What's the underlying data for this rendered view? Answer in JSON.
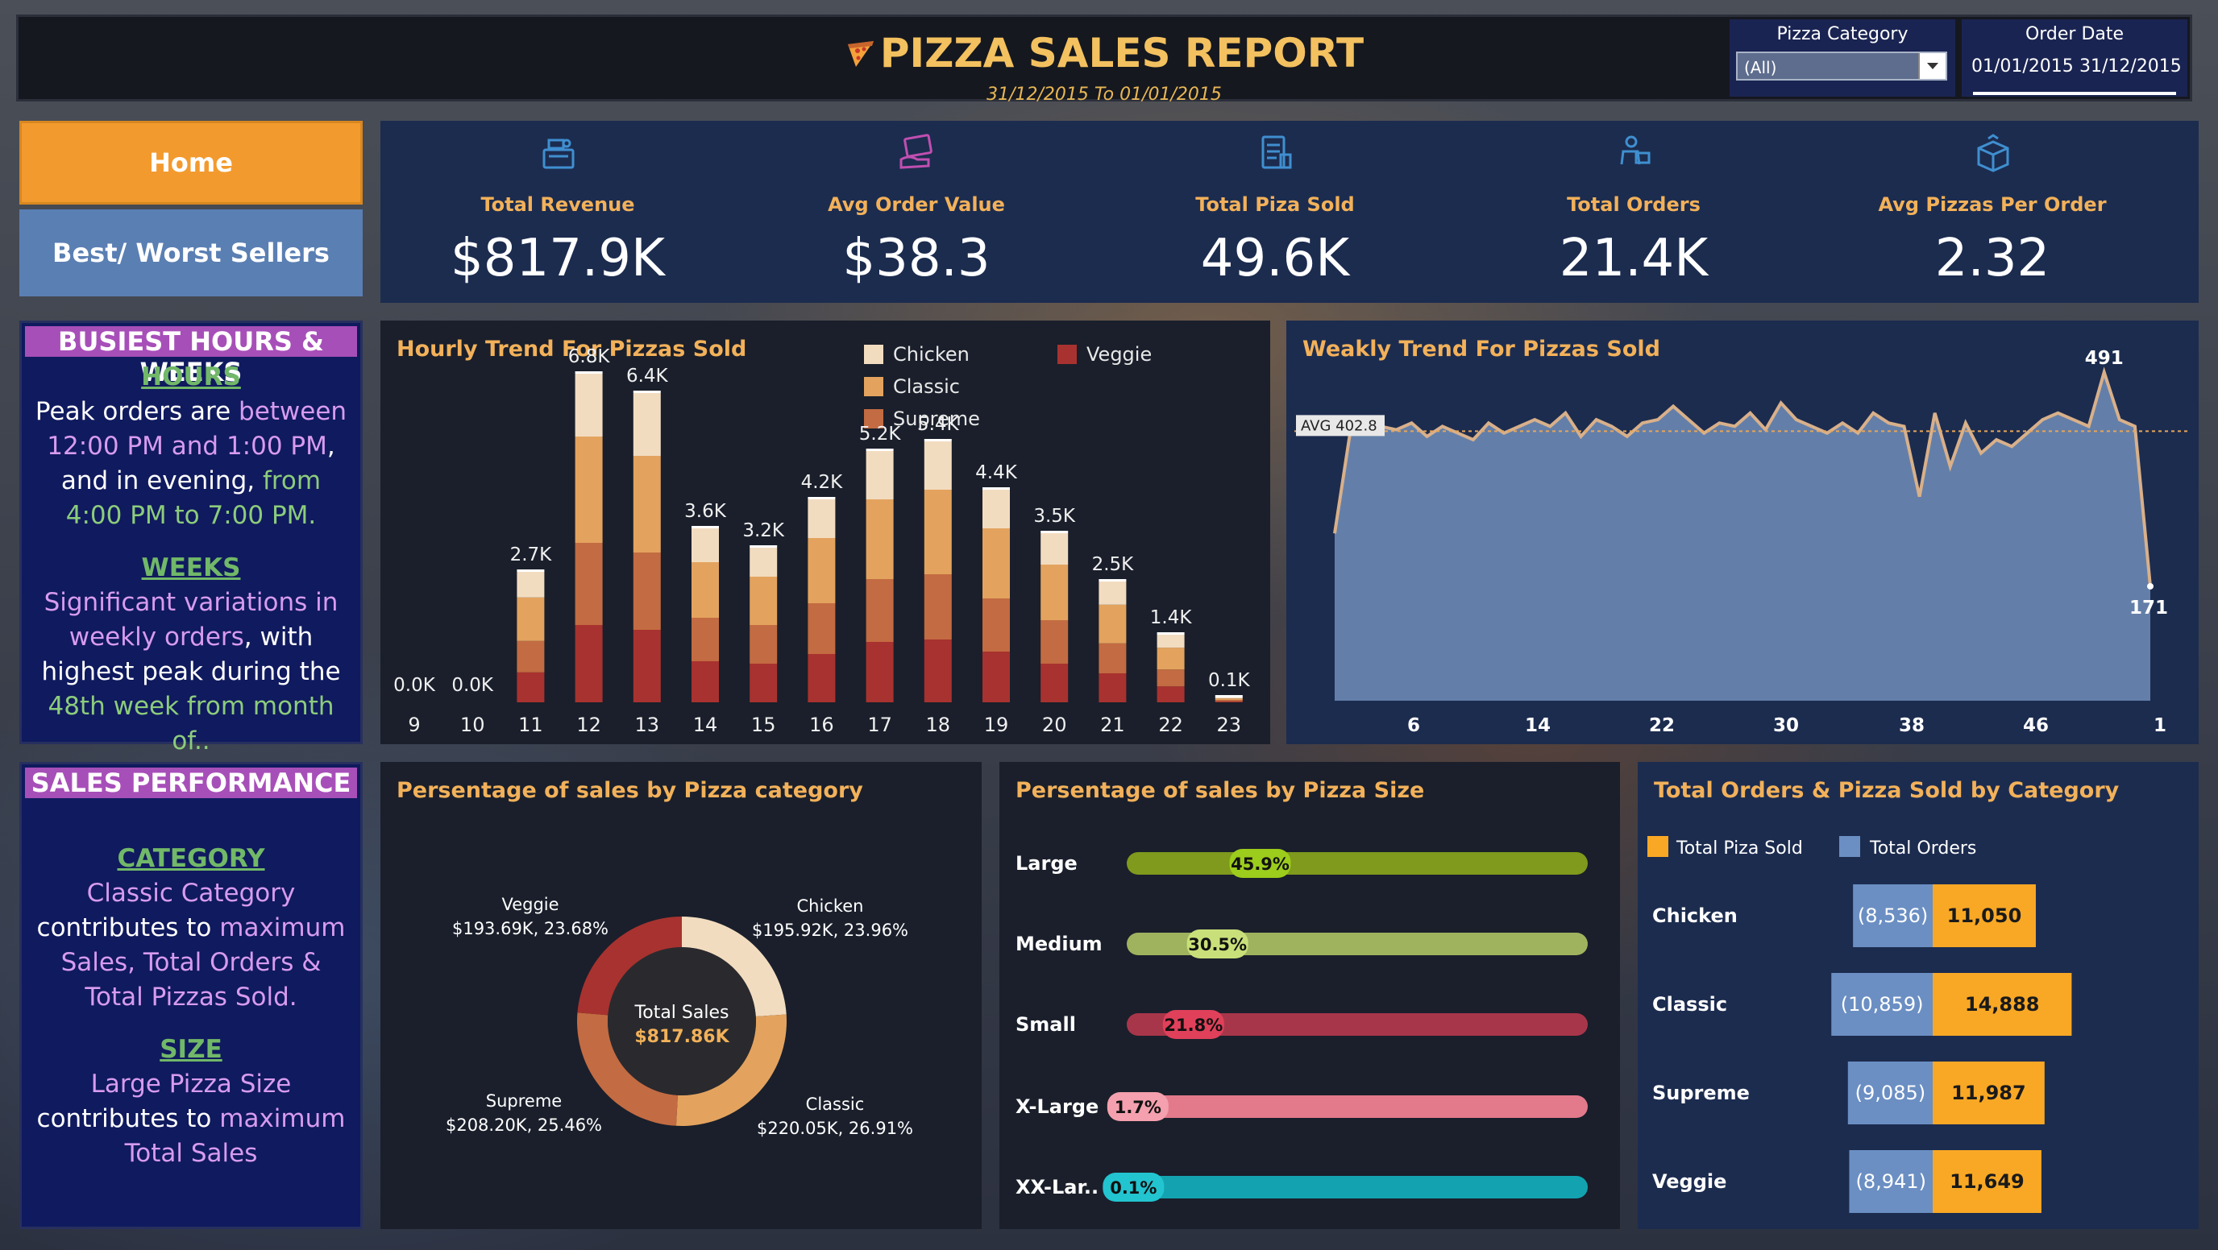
{
  "header": {
    "title": "PIZZA SALES REPORT",
    "subtitle": "31/12/2015 To 01/01/2015"
  },
  "filters": {
    "category_label": "Pizza Category",
    "category_value": "(All)",
    "date_label": "Order Date",
    "date_start": "01/01/2015",
    "date_end": "31/12/2015"
  },
  "nav": {
    "home": "Home",
    "best_worst": "Best/ Worst Sellers"
  },
  "kpis": [
    {
      "label": "Total Revenue",
      "value": "$817.9K",
      "icon": "cash-register-icon"
    },
    {
      "label": "Avg Order Value",
      "value": "$38.3",
      "icon": "payment-card-icon"
    },
    {
      "label": "Total Piza Sold",
      "value": "49.6K",
      "icon": "receipt-list-icon"
    },
    {
      "label": "Total Orders",
      "value": "21.4K",
      "icon": "delivery-person-icon"
    },
    {
      "label": "Avg Pizzas Per Order",
      "value": "2.32",
      "icon": "package-box-icon"
    }
  ],
  "busy": {
    "title": "BUSIEST HOURS & WEEKS",
    "hours_head": "HOURS",
    "weeks_head": "WEEKS"
  },
  "perf": {
    "title": "SALES PERFORMANCE",
    "category_head": "CATEGORY",
    "size_head": "SIZE"
  },
  "colors": {
    "Chicken": "#f2dcc0",
    "Classic": "#e3a35e",
    "Supreme": "#c36b42",
    "Veggie": "#a8322f",
    "accent": "#f2b15a",
    "area": "#6b88b2"
  },
  "chart_data": [
    {
      "id": "hourly",
      "type": "bar",
      "title": "Hourly Trend For Pizzas Sold",
      "stacked": true,
      "categories": [
        "9",
        "10",
        "11",
        "12",
        "13",
        "14",
        "15",
        "16",
        "17",
        "18",
        "19",
        "20",
        "21",
        "22",
        "23"
      ],
      "totals_labels": [
        "0.0K",
        "0.0K",
        "2.7K",
        "6.8K",
        "6.4K",
        "3.6K",
        "3.2K",
        "4.2K",
        "5.2K",
        "5.4K",
        "4.4K",
        "3.5K",
        "2.5K",
        "1.4K",
        "0.1K"
      ],
      "series": [
        {
          "name": "Veggie",
          "values": [
            0.0,
            0.0,
            0.62,
            1.6,
            1.5,
            0.85,
            0.8,
            1.0,
            1.25,
            1.3,
            1.05,
            0.8,
            0.6,
            0.33,
            0.02
          ]
        },
        {
          "name": "Supreme",
          "values": [
            0.0,
            0.0,
            0.65,
            1.7,
            1.6,
            0.9,
            0.8,
            1.05,
            1.3,
            1.35,
            1.1,
            0.9,
            0.62,
            0.35,
            0.03
          ]
        },
        {
          "name": "Classic",
          "values": [
            0.0,
            0.0,
            0.9,
            2.2,
            2.0,
            1.15,
            1.0,
            1.35,
            1.65,
            1.75,
            1.45,
            1.15,
            0.8,
            0.45,
            0.03
          ]
        },
        {
          "name": "Chicken",
          "values": [
            0.0,
            0.0,
            0.53,
            1.3,
            1.3,
            0.7,
            0.6,
            0.8,
            1.0,
            1.0,
            0.8,
            0.65,
            0.48,
            0.27,
            0.02
          ]
        }
      ],
      "legend": [
        "Chicken",
        "Classic",
        "Supreme",
        "Veggie"
      ],
      "ylim": [
        0,
        7
      ]
    },
    {
      "id": "weekly",
      "type": "area",
      "title": "Weakly Trend For Pizzas Sold",
      "x_ticks": [
        "6",
        "14",
        "22",
        "30",
        "38",
        "46",
        "1"
      ],
      "values": [
        250,
        400,
        405,
        410,
        405,
        415,
        395,
        410,
        400,
        390,
        415,
        400,
        410,
        420,
        410,
        430,
        395,
        420,
        410,
        395,
        415,
        420,
        440,
        420,
        400,
        415,
        410,
        430,
        405,
        445,
        420,
        410,
        400,
        415,
        400,
        430,
        415,
        410,
        305,
        430,
        350,
        415,
        370,
        390,
        380,
        400,
        420,
        430,
        420,
        410,
        491,
        420,
        410,
        171
      ],
      "avg_label": "AVG 402.8",
      "avg": 402.8,
      "peak_label": "491",
      "end_label": "171",
      "ylim": [
        0,
        520
      ]
    },
    {
      "id": "category_pct",
      "type": "pie",
      "title": "Persentage of sales by Pizza category",
      "center_label": "Total Sales",
      "center_value": "$817.86K",
      "slices": [
        {
          "name": "Chicken",
          "value": 23.96,
          "label1": "Chicken",
          "label2": "$195.92K, 23.96%"
        },
        {
          "name": "Classic",
          "value": 26.91,
          "label1": "Classic",
          "label2": "$220.05K, 26.91%"
        },
        {
          "name": "Supreme",
          "value": 25.46,
          "label1": "Supreme",
          "label2": "$208.20K, 25.46%"
        },
        {
          "name": "Veggie",
          "value": 23.68,
          "label1": "Veggie",
          "label2": "$193.69K, 23.68%"
        }
      ]
    },
    {
      "id": "size_pct",
      "type": "bar",
      "title": "Persentage of sales by Pizza Size",
      "categories": [
        "Large",
        "Medium",
        "Small",
        "X-Large",
        "XX-Lar.."
      ],
      "values": [
        45.9,
        30.5,
        21.8,
        1.7,
        0.1
      ],
      "value_labels": [
        "45.9%",
        "30.5%",
        "21.8%",
        "1.7%",
        "0.1%"
      ],
      "bar_colors": [
        "#7f9a1c",
        "#9fb35e",
        "#a8364a",
        "#e27a8c",
        "#13a3b0"
      ],
      "label_colors": [
        "#9ccc1c",
        "#c9e07a",
        "#e0405a",
        "#f4a0ae",
        "#22c4d0"
      ],
      "xlim": [
        0,
        100
      ]
    },
    {
      "id": "orders_by_cat",
      "type": "bar",
      "title": "Total Orders & Pizza Sold by Category",
      "categories": [
        "Chicken",
        "Classic",
        "Supreme",
        "Veggie"
      ],
      "series": [
        {
          "name": "Total Orders",
          "values": [
            8536,
            10859,
            9085,
            8941
          ],
          "labels": [
            "(8,536)",
            "(10,859)",
            "(9,085)",
            "(8,941)"
          ]
        },
        {
          "name": "Total Piza Sold",
          "values": [
            11050,
            14888,
            11987,
            11649
          ],
          "labels": [
            "11,050",
            "14,888",
            "11,987",
            "11,649"
          ]
        }
      ],
      "legend": [
        "Total Piza Sold",
        "Total Orders"
      ]
    }
  ]
}
